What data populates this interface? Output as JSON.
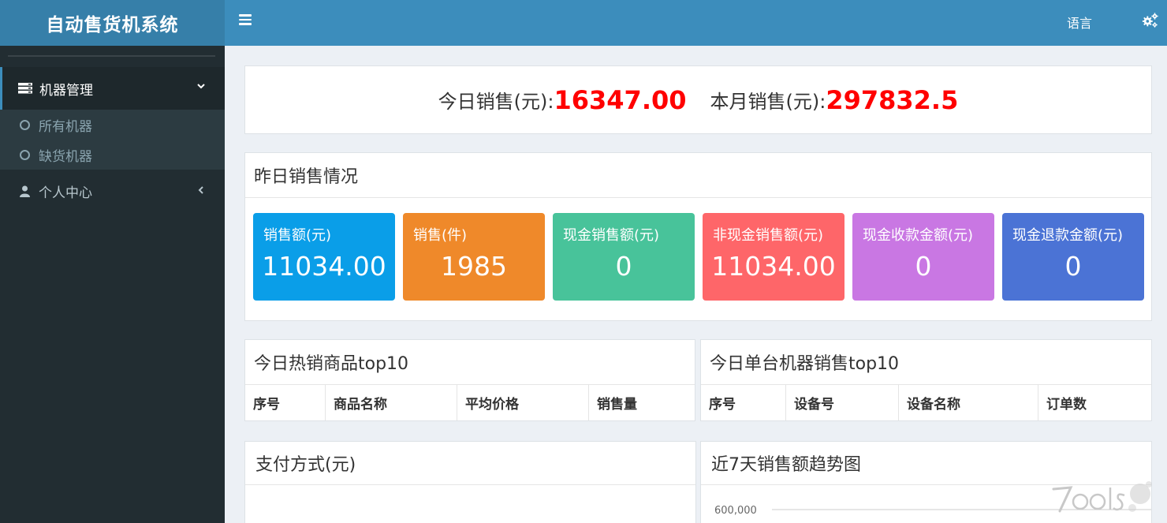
{
  "app": {
    "title": "自动售货机系统"
  },
  "navbar": {
    "language_label": "语言",
    "menu_icon": "hamburger-icon",
    "settings_icon": "gears-icon"
  },
  "sidebar": {
    "machine_menu": {
      "label": "机器管理",
      "icon": "server-icon",
      "expanded": true,
      "items": [
        {
          "label": "所有机器"
        },
        {
          "label": "缺货机器"
        }
      ]
    },
    "profile_menu": {
      "label": "个人中心",
      "icon": "user-icon",
      "expanded": false
    }
  },
  "totals": {
    "today_label": "今日销售(元):",
    "today_value": "16347.00",
    "month_label": "本月销售(元):",
    "month_value": "297832.5",
    "value_color": "#ff0000"
  },
  "yesterday": {
    "title": "昨日销售情况",
    "cards": [
      {
        "label": "销售额(元)",
        "value": "11034.00",
        "color": "#0a9ee8"
      },
      {
        "label": "销售(件)",
        "value": "1985",
        "color": "#ef892a"
      },
      {
        "label": "现金销售额(元)",
        "value": "0",
        "color": "#48c39a"
      },
      {
        "label": "非现金销售额(元)",
        "value": "11034.00",
        "color": "#fe6669"
      },
      {
        "label": "现金收款金额(元)",
        "value": "0",
        "color": "#c977e3"
      },
      {
        "label": "现金退款金额(元)",
        "value": "0",
        "color": "#4b73d5"
      }
    ]
  },
  "hot_products": {
    "title": "今日热销商品top10",
    "columns": [
      "序号",
      "商品名称",
      "平均价格",
      "销售量"
    ]
  },
  "machine_sales": {
    "title": "今日单台机器销售top10",
    "columns": [
      "序号",
      "设备号",
      "设备名称",
      "订单数"
    ]
  },
  "payment": {
    "title": "支付方式(元)"
  },
  "trend": {
    "title": "近7天销售额趋势图"
  },
  "chart_data": {
    "type": "line",
    "title": "近7天销售额趋势图",
    "y_tick_labels": [
      "600,000"
    ]
  },
  "watermark": {
    "text": "7OOLS"
  }
}
